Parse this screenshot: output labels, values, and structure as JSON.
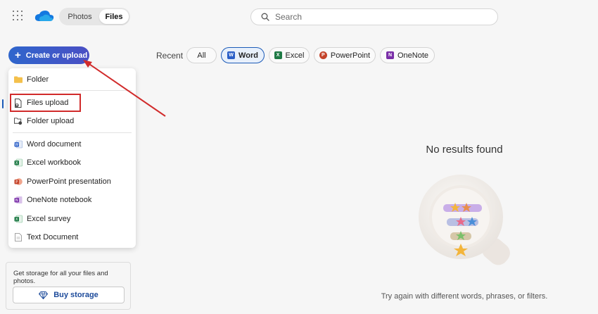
{
  "topbar": {
    "tabs": [
      {
        "label": "Photos"
      },
      {
        "label": "Files"
      }
    ],
    "search": {
      "placeholder": "Search"
    }
  },
  "create_button": {
    "label": "Create or upload"
  },
  "filters": {
    "recent_label": "Recent",
    "chips": [
      {
        "label": "All",
        "icon": null
      },
      {
        "label": "Word",
        "icon": "word-icon",
        "color": "#2b5fc7"
      },
      {
        "label": "Excel",
        "icon": "excel-icon",
        "color": "#1e7a45"
      },
      {
        "label": "PowerPoint",
        "icon": "powerpoint-icon",
        "color": "#c4432a"
      },
      {
        "label": "OneNote",
        "icon": "onenote-icon",
        "color": "#7a2fa8"
      }
    ]
  },
  "menu": {
    "items": [
      {
        "label": "Folder",
        "icon": "folder-icon"
      },
      {
        "label": "Files upload",
        "icon": "file-upload-icon"
      },
      {
        "label": "Folder upload",
        "icon": "folder-upload-icon"
      },
      {
        "label": "Word document",
        "icon": "word-icon"
      },
      {
        "label": "Excel workbook",
        "icon": "excel-icon"
      },
      {
        "label": "PowerPoint presentation",
        "icon": "powerpoint-icon"
      },
      {
        "label": "OneNote notebook",
        "icon": "onenote-icon"
      },
      {
        "label": "Excel survey",
        "icon": "excel-icon"
      },
      {
        "label": "Text Document",
        "icon": "text-document-icon"
      }
    ]
  },
  "storage": {
    "text": "Get storage for all your files and photos.",
    "button_label": "Buy storage"
  },
  "empty_state": {
    "title": "No results found",
    "subtitle": "Try again with different words, phrases, or filters."
  },
  "colors": {
    "accent": "#2f66cc",
    "annotation": "#d12b2b"
  }
}
